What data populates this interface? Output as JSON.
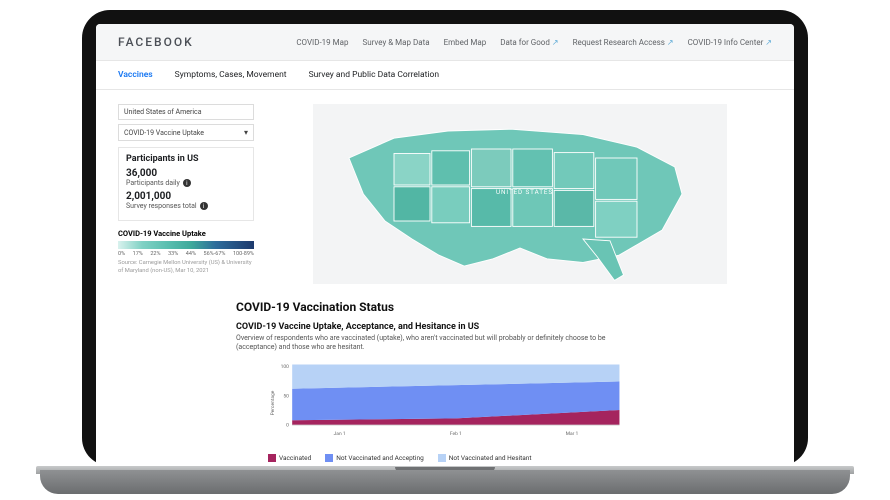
{
  "brand": "FACEBOOK",
  "nav": [
    {
      "label": "COVID-19 Map",
      "ext": false
    },
    {
      "label": "Survey & Map Data",
      "ext": false
    },
    {
      "label": "Embed Map",
      "ext": false
    },
    {
      "label": "Data for Good",
      "ext": true
    },
    {
      "label": "Request Research Access",
      "ext": true
    },
    {
      "label": "COVID-19 Info Center",
      "ext": true
    }
  ],
  "tabs": [
    {
      "label": "Vaccines",
      "active": true
    },
    {
      "label": "Symptoms, Cases, Movement",
      "active": false
    },
    {
      "label": "Survey and Public Data Correlation",
      "active": false
    }
  ],
  "selects": {
    "region": "United States of America",
    "metric": "COVID-19 Vaccine Uptake"
  },
  "participants": {
    "title": "Participants in US",
    "daily_value": "36,000",
    "daily_label": "Participants daily",
    "total_value": "2,001,000",
    "total_label": "Survey responses total"
  },
  "legend": {
    "title": "COVID-19 Vaccine Uptake",
    "ticks": [
      "0%",
      "17%",
      "22%",
      "33%",
      "44%",
      "56%-67%",
      "100-89%"
    ],
    "source": "Source: Carnegie Mellon University (US) & University of Maryland (non-US), Mar 10, 2021"
  },
  "map": {
    "label": "UNITED STATES"
  },
  "section_title": "COVID-19 Vaccination Status",
  "chart": {
    "title": "COVID-19 Vaccine Uptake, Acceptance, and Hesitance in US",
    "subtitle": "Overview of respondents who are vaccinated (uptake), who aren't vaccinated but will probably or definitely choose to be (acceptance) and those who are hesitant.",
    "ylabel": "Percentage",
    "colors": {
      "vaccinated": "#a5245e",
      "accepting": "#6f8ff3",
      "hesitant": "#b7d2f6"
    }
  },
  "chart_data": {
    "type": "area",
    "x": [
      "Jan 1",
      "Feb 1",
      "Mar 1"
    ],
    "ylim": [
      0,
      100
    ],
    "yticks": [
      0,
      50,
      100
    ],
    "series": [
      {
        "name": "Vaccinated",
        "color": "#a5245e",
        "values": [
          8,
          11,
          25
        ]
      },
      {
        "name": "Not Vaccinated and Accepting",
        "color": "#6f8ff3",
        "values": [
          52,
          55,
          47
        ]
      },
      {
        "name": "Not Vaccinated and Hesitant",
        "color": "#b7d2f6",
        "values": [
          40,
          34,
          28
        ]
      }
    ]
  }
}
